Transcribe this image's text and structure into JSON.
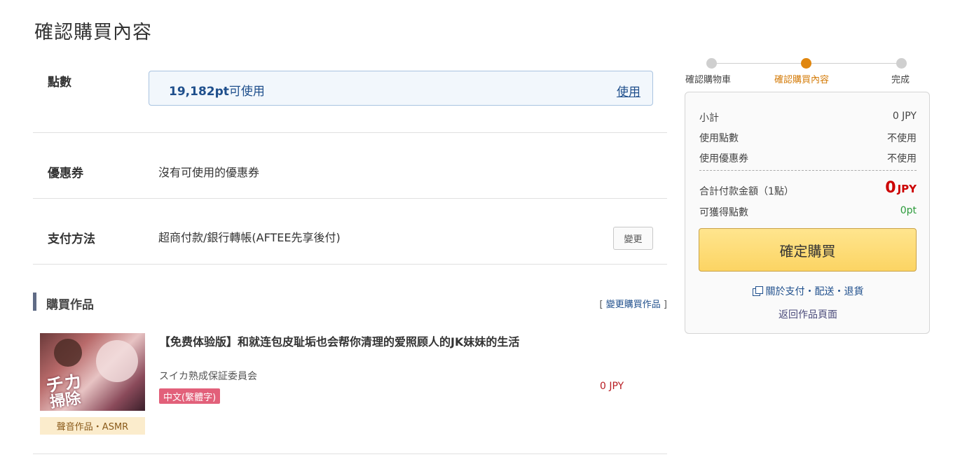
{
  "page": {
    "title": "確認購買內容"
  },
  "points": {
    "label": "點數",
    "available": "19,182pt",
    "available_suffix": "可使用",
    "use_label": "使用"
  },
  "coupon": {
    "label": "優惠券",
    "value": "沒有可使用的優惠券"
  },
  "payment": {
    "label": "支付方法",
    "value": "超商付款/銀行轉帳(AFTEE先享後付)",
    "change_label": "變更"
  },
  "works": {
    "section_title": "購買作品",
    "change_link_open": "[",
    "change_link": "變更購買作品",
    "change_link_close": "]",
    "items": [
      {
        "title": "【免费体验版】和就连包皮耻垢也会帮你清理的爱照顾人的JK妹妹的生活",
        "circle": "スイカ熟成保証委員会",
        "language": "中文(繁體字)",
        "category": "聲音作品・ASMR",
        "price": "0 JPY",
        "cover_text_1": "チカ",
        "cover_text_2": "掃除"
      }
    ]
  },
  "steps": [
    {
      "label": "確認購物車",
      "active": false
    },
    {
      "label": "確認購買內容",
      "active": true
    },
    {
      "label": "完成",
      "active": false
    }
  ],
  "summary": {
    "subtotal_label": "小計",
    "subtotal_value": "0 JPY",
    "points_label": "使用點數",
    "points_value": "不使用",
    "coupon_label": "使用優惠券",
    "coupon_value": "不使用",
    "total_label": "合計付款金額（1點）",
    "total_amount": "0",
    "total_currency": "JPY",
    "earn_label": "可獲得點數",
    "earn_value": "0pt",
    "confirm_label": "確定購買",
    "help_link": "關於支付・配送・退貨",
    "back_link": "返回作品頁面"
  },
  "colors": {
    "accent_orange": "#e0860e",
    "price_red": "#c00000",
    "link_blue": "#1f4f8c",
    "earn_green": "#2a9a3a",
    "button_yellow": "#fcd463",
    "lang_badge": "#e2607a"
  }
}
